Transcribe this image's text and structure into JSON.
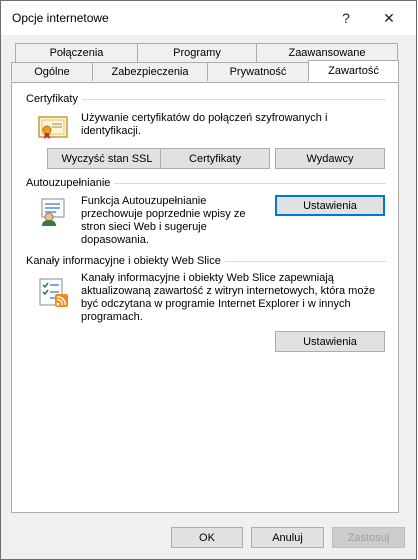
{
  "window": {
    "title": "Opcje internetowe",
    "help_glyph": "?",
    "close_glyph": "✕"
  },
  "tabs": {
    "row_back": [
      "Połączenia",
      "Programy",
      "Zaawansowane"
    ],
    "row_front": [
      "Ogólne",
      "Zabezpieczenia",
      "Prywatność",
      "Zawartość"
    ],
    "active": "Zawartość"
  },
  "certificates": {
    "heading": "Certyfikaty",
    "description": "Używanie certyfikatów do połączeń szyfrowanych i identyfikacji.",
    "buttons": [
      "Wyczyść stan SSL",
      "Certyfikaty",
      "Wydawcy"
    ]
  },
  "autocomplete": {
    "heading": "Autouzupełnianie",
    "description": "Funkcja Autouzupełnianie przechowuje poprzednie wpisy ze stron sieci Web i sugeruje dopasowania.",
    "button": "Ustawienia"
  },
  "feeds": {
    "heading": "Kanały informacyjne i obiekty Web Slice",
    "description": "Kanały informacyjne i obiekty Web Slice zapewniają aktualizowaną zawartość z witryn internetowych, która może być odczytana w programie Internet Explorer i w innych programach.",
    "button": "Ustawienia"
  },
  "footer": {
    "ok": "OK",
    "cancel": "Anuluj",
    "apply": "Zastosuj"
  },
  "icons": {
    "certificate": "certificate-icon",
    "autocomplete": "autocomplete-user-icon",
    "feeds": "rss-feeds-icon"
  }
}
